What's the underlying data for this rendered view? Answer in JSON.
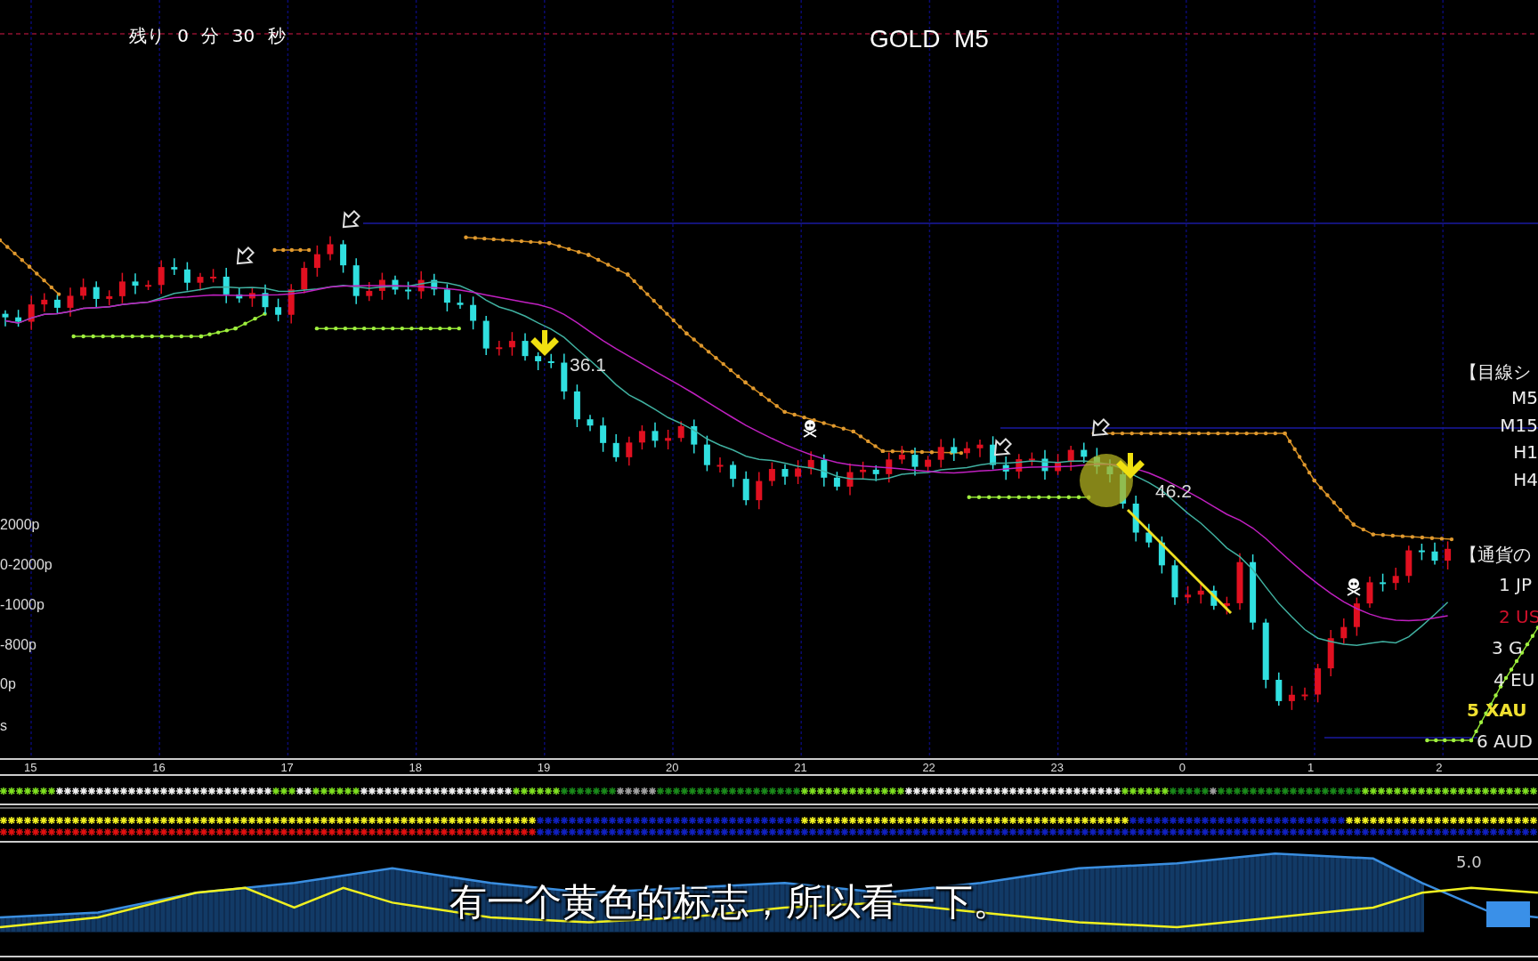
{
  "header": {
    "timer": "残り 0 分 30 秒",
    "title": "GOLD  M5"
  },
  "chart": {
    "annotations": [
      "36.1",
      "46.2"
    ],
    "left_labels": [
      "2000p",
      "0-2000p",
      "-1000p",
      "-800p",
      "0p",
      "s"
    ],
    "sight_signal": {
      "title": "【目線シ",
      "timeframes": [
        "M5",
        "M15",
        "H1",
        "H4"
      ]
    },
    "currency_strength": {
      "title": "【通貨の",
      "items": [
        {
          "label": "1 JP",
          "color": "#e8e8e8",
          "selected": false
        },
        {
          "label": "2 US",
          "color": "#d0102a",
          "selected": false
        },
        {
          "label": "3 G",
          "color": "#e8e8e8",
          "selected": false
        },
        {
          "label": "4 EU",
          "color": "#e8e8e8",
          "selected": false
        },
        {
          "label": "5 XAU",
          "color": "#f0e030",
          "selected": true
        },
        {
          "label": "6 AUD",
          "color": "#e8e8e8",
          "selected": false
        }
      ]
    }
  },
  "time_axis": {
    "labels": [
      "15",
      "16",
      "17",
      "18",
      "19",
      "20",
      "21",
      "22",
      "23",
      "0",
      "1",
      "2"
    ]
  },
  "oscillator": {
    "value": "5.0"
  },
  "subtitle": "有一个黄色的标志，所以看一下。"
}
